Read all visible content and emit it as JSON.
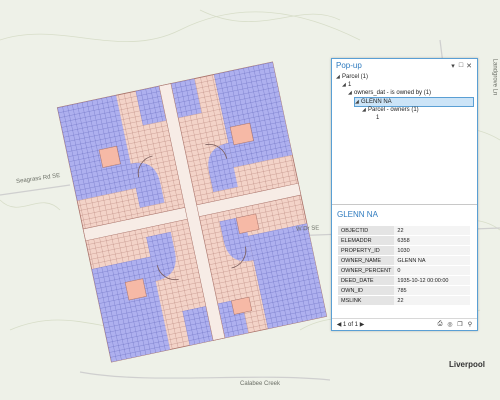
{
  "map": {
    "labels": {
      "road_left": "Seagrass Rd SE",
      "road_right": "W Dr SE",
      "road_top_right": "Landgrove Ln",
      "place": "Liverpool",
      "creek": "Calabee Creek"
    }
  },
  "popup": {
    "title": "Pop-up",
    "tree": [
      {
        "label": "Parcel (1)",
        "expanded": true
      },
      {
        "label": "1",
        "expanded": true
      },
      {
        "label": "owners_dat - is owned by (1)",
        "expanded": true
      },
      {
        "label": "GLENN NA",
        "expanded": true,
        "selected": true
      },
      {
        "label": "Parcel - owners (1)",
        "expanded": true
      },
      {
        "label": "1",
        "expanded": false
      }
    ],
    "feature_title": "GLENN NA",
    "attributes": [
      {
        "key": "OBJECTID",
        "value": "22"
      },
      {
        "key": "ELEMADDR",
        "value": "6358"
      },
      {
        "key": "PROPERTY_ID",
        "value": "1030"
      },
      {
        "key": "OWNER_NAME",
        "value": "GLENN NA"
      },
      {
        "key": "OWNER_PERCENT",
        "value": "0"
      },
      {
        "key": "DEED_DATE",
        "value": "1935-10-12 00:00:00"
      },
      {
        "key": "OWN_ID",
        "value": "785"
      },
      {
        "key": "MSLINK",
        "value": "22"
      }
    ],
    "pager": "1 of 1"
  }
}
